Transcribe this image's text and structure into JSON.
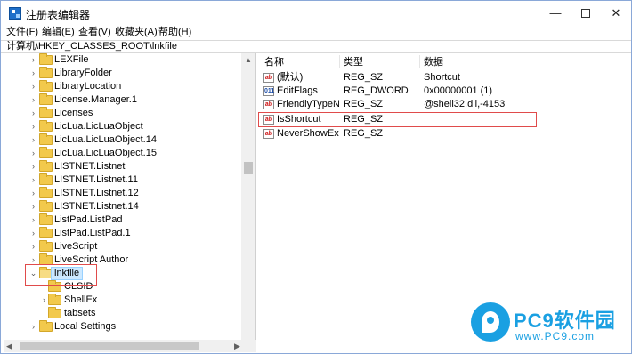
{
  "window": {
    "title": "注册表编辑器",
    "controls": {
      "minimize": "—",
      "close": "✕"
    }
  },
  "menu": [
    "文件(F)",
    "编辑(E)",
    "查看(V)",
    "收藏夹(A)",
    "帮助(H)"
  ],
  "address": "计算机\\HKEY_CLASSES_ROOT\\lnkfile",
  "tree": {
    "items": [
      {
        "label": "LEXFile"
      },
      {
        "label": "LibraryFolder"
      },
      {
        "label": "LibraryLocation"
      },
      {
        "label": "License.Manager.1"
      },
      {
        "label": "Licenses"
      },
      {
        "label": "LicLua.LicLuaObject"
      },
      {
        "label": "LicLua.LicLuaObject.14"
      },
      {
        "label": "LicLua.LicLuaObject.15"
      },
      {
        "label": "LISTNET.Listnet"
      },
      {
        "label": "LISTNET.Listnet.11"
      },
      {
        "label": "LISTNET.Listnet.12"
      },
      {
        "label": "LISTNET.Listnet.14"
      },
      {
        "label": "ListPad.ListPad"
      },
      {
        "label": "ListPad.ListPad.1"
      },
      {
        "label": "LiveScript"
      },
      {
        "label": "LiveScript Author"
      },
      {
        "label": "lnkfile",
        "selected": true,
        "expanded": true
      },
      {
        "label": "CLSID",
        "child": true
      },
      {
        "label": "ShellEx",
        "child": true,
        "expandable": true
      },
      {
        "label": "tabsets",
        "child": true
      },
      {
        "label": "Local Settings"
      }
    ]
  },
  "list": {
    "headers": {
      "name": "名称",
      "type": "类型",
      "data": "数据"
    },
    "rows": [
      {
        "name": "(默认)",
        "type": "REG_SZ",
        "data": "Shortcut",
        "icon": "string-value-icon"
      },
      {
        "name": "EditFlags",
        "type": "REG_DWORD",
        "data": "0x00000001 (1)",
        "icon": "binary-value-icon"
      },
      {
        "name": "FriendlyTypeN...",
        "type": "REG_SZ",
        "data": "@shell32.dll,-4153",
        "icon": "string-value-icon"
      },
      {
        "name": "IsShortcut",
        "type": "REG_SZ",
        "data": "",
        "icon": "string-value-icon"
      },
      {
        "name": "NeverShowExt",
        "type": "REG_SZ",
        "data": "",
        "icon": "string-value-icon"
      }
    ]
  },
  "brand": {
    "name": "PC9软件园",
    "url": "www.PC9.com"
  },
  "colors": {
    "accent": "#1aa0e2",
    "highlight": "#e04b4b",
    "selection": "#cce8ff",
    "folder": "#f2c94c"
  }
}
